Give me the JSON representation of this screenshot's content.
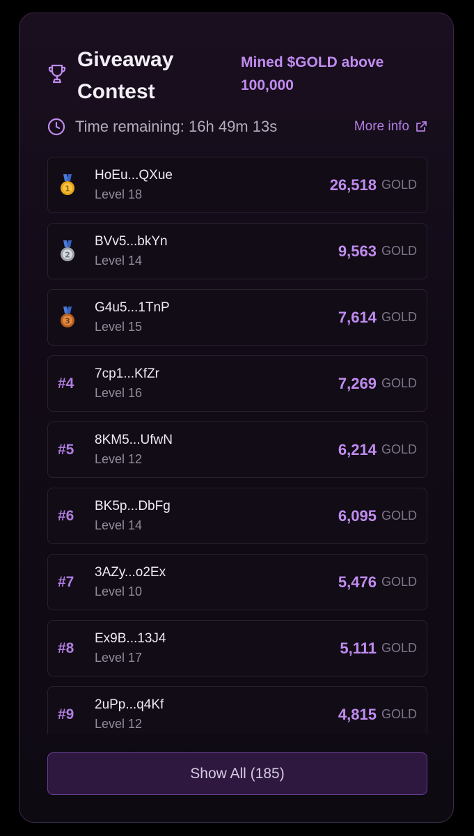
{
  "contest": {
    "title": "Giveaway Contest",
    "subtitle": "Mined $GOLD above 100,000",
    "time_remaining": "Time remaining: 16h 49m 13s",
    "more_info_label": "More info"
  },
  "colors": {
    "accent": "#c08cf0",
    "gold_medal": "#e8a317",
    "silver_medal": "#b8bcc4",
    "bronze_medal": "#c9752b"
  },
  "leaderboard": [
    {
      "rank": "1",
      "medal": "gold-medal-icon",
      "name": "HoEu...QXue",
      "level": "Level 18",
      "amount": "26,518",
      "unit": "GOLD"
    },
    {
      "rank": "2",
      "medal": "silver-medal-icon",
      "name": "BVv5...bkYn",
      "level": "Level 14",
      "amount": "9,563",
      "unit": "GOLD"
    },
    {
      "rank": "3",
      "medal": "bronze-medal-icon",
      "name": "G4u5...1TnP",
      "level": "Level 15",
      "amount": "7,614",
      "unit": "GOLD"
    },
    {
      "rank": "#4",
      "name": "7cp1...KfZr",
      "level": "Level 16",
      "amount": "7,269",
      "unit": "GOLD"
    },
    {
      "rank": "#5",
      "name": "8KM5...UfwN",
      "level": "Level 12",
      "amount": "6,214",
      "unit": "GOLD"
    },
    {
      "rank": "#6",
      "name": "BK5p...DbFg",
      "level": "Level 14",
      "amount": "6,095",
      "unit": "GOLD"
    },
    {
      "rank": "#7",
      "name": "3AZy...o2Ex",
      "level": "Level 10",
      "amount": "5,476",
      "unit": "GOLD"
    },
    {
      "rank": "#8",
      "name": "Ex9B...13J4",
      "level": "Level 17",
      "amount": "5,111",
      "unit": "GOLD"
    },
    {
      "rank": "#9",
      "name": "2uPp...q4Kf",
      "level": "Level 12",
      "amount": "4,815",
      "unit": "GOLD"
    }
  ],
  "show_all_label": "Show All (185)"
}
